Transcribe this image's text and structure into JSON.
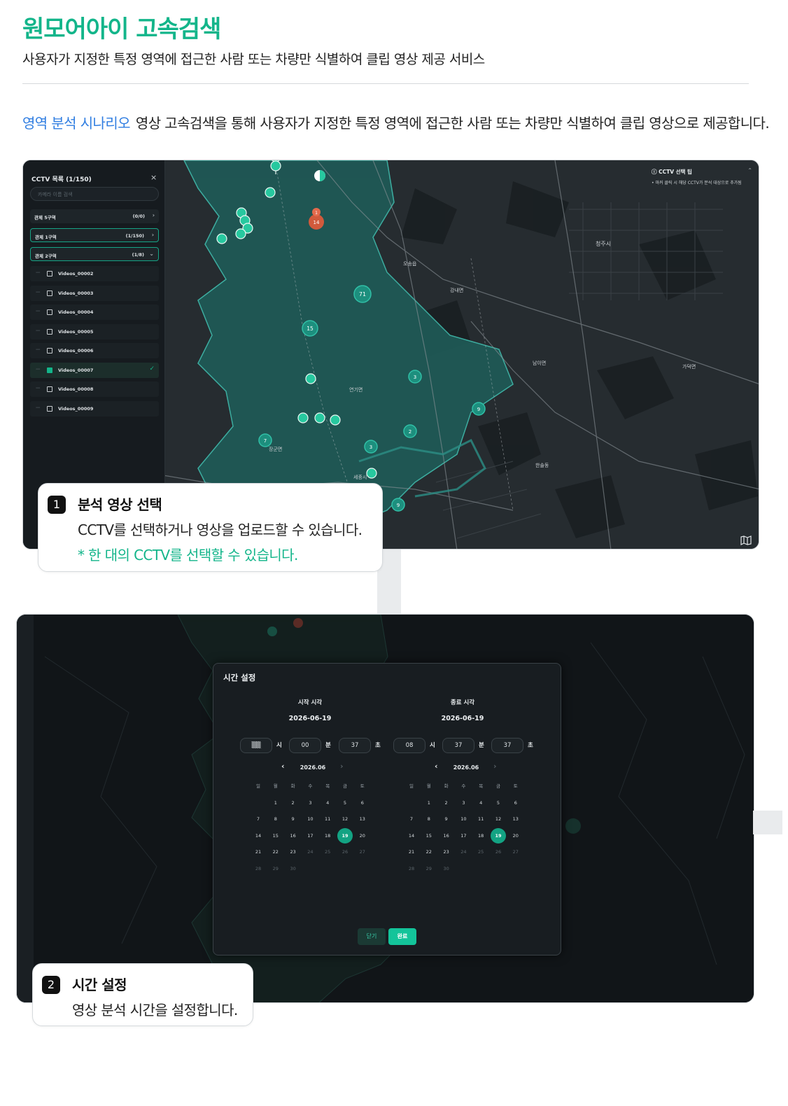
{
  "header": {
    "title": "원모어아이 고속검색",
    "subtitle": "사용자가 지정한 특정 영역에 접근한 사람 또는 차량만 식별하여 클립 영상 제공 서비스",
    "scenario_tag": "영역 분석 시나리오",
    "scenario_text": "영상 고속검색을 통해 사용자가 지정한 특정 영역에 접근한 사람 또는 차량만 식별하여 클립 영상으로 제공합니다."
  },
  "sidebar": {
    "title": "CCTV 목록 (1/150)",
    "close": "×",
    "search_placeholder": "카메라 이름 검색",
    "regions": [
      {
        "label": "관제 5구역",
        "count": "(0/0)",
        "arrow": "›"
      },
      {
        "label": "관제 1구역",
        "count": "(1/150)",
        "arrow": "›"
      },
      {
        "label": "관제 2구역",
        "count": "(1/8)",
        "arrow": "⌄"
      }
    ],
    "items": [
      {
        "label": "Videos_00002",
        "checked": false
      },
      {
        "label": "Videos_00003",
        "checked": false
      },
      {
        "label": "Videos_00004",
        "checked": false
      },
      {
        "label": "Videos_00005",
        "checked": false
      },
      {
        "label": "Videos_00006",
        "checked": false
      },
      {
        "label": "Videos_00007",
        "checked": true
      },
      {
        "label": "Videos_00008",
        "checked": false
      },
      {
        "label": "Videos_00009",
        "checked": false
      }
    ]
  },
  "map": {
    "tip_title": "ⓘ CCTV 선택 팁",
    "tip_text": "• 마커 클릭 시 해당 CCTV가 분석 대상으로 추가됨",
    "tip_collapse": "⌃",
    "clusters": [
      "71",
      "15",
      "3",
      "9",
      "2",
      "3",
      "7",
      "9"
    ],
    "alert_cluster": "14",
    "alert_badge": "1",
    "places": [
      "청주시",
      "세종시",
      "한솔동",
      "장군면",
      "연기면",
      "남이면",
      "강내면",
      "오송읍",
      "가덕면"
    ]
  },
  "step1": {
    "number": "1",
    "title": "분석 영상 선택",
    "text": "CCTV를 선택하거나 영상을 업로드할 수 있습니다.",
    "note": "* 한 대의 CCTV를 선택할 수 있습니다."
  },
  "time_modal": {
    "title": "시간 설정",
    "start": {
      "label": "시작 시각",
      "date": "2026-06-19",
      "hour": "▒▒",
      "minute": "00",
      "second": "37",
      "month": "2026.06"
    },
    "end": {
      "label": "종료 시각",
      "date": "2026-06-19",
      "hour": "08",
      "minute": "37",
      "second": "37",
      "month": "2026.06"
    },
    "units": {
      "hour": "시",
      "minute": "분",
      "second": "초"
    },
    "nav_prev": "‹",
    "nav_next": "›",
    "weekdays": [
      "일",
      "월",
      "화",
      "수",
      "목",
      "금",
      "토"
    ],
    "days": [
      "1",
      "2",
      "3",
      "4",
      "5",
      "6",
      "7",
      "8",
      "9",
      "10",
      "11",
      "12",
      "13",
      "14",
      "15",
      "16",
      "17",
      "18",
      "19",
      "20",
      "21",
      "22",
      "23",
      "24",
      "25",
      "26",
      "27",
      "28",
      "29",
      "30"
    ],
    "selected_day": "19",
    "close_label": "닫기",
    "done_label": "완료"
  },
  "step2": {
    "number": "2",
    "title": "시간 설정",
    "text": "영상 분석 시간을 설정합니다."
  },
  "colors": {
    "accent": "#13b58a",
    "link": "#2f7de1",
    "map_dark": "#20262a",
    "map_region": "#1f5a57"
  }
}
